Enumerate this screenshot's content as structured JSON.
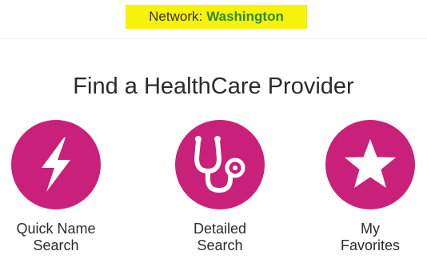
{
  "header": {
    "network_label": "Network:",
    "network_name": "Washington"
  },
  "main": {
    "title": "Find a HealthCare Provider",
    "options": [
      {
        "label_line1": "Quick Name",
        "label_line2": "Search",
        "icon": "lightning-bolt-icon"
      },
      {
        "label_line1": "Detailed",
        "label_line2": "Search",
        "icon": "stethoscope-icon"
      },
      {
        "label_line1": "My",
        "label_line2": "Favorites",
        "icon": "star-icon"
      }
    ]
  },
  "colors": {
    "accent": "#c9217a",
    "highlight": "#f6f20a",
    "network_name": "#2e8b2e"
  }
}
